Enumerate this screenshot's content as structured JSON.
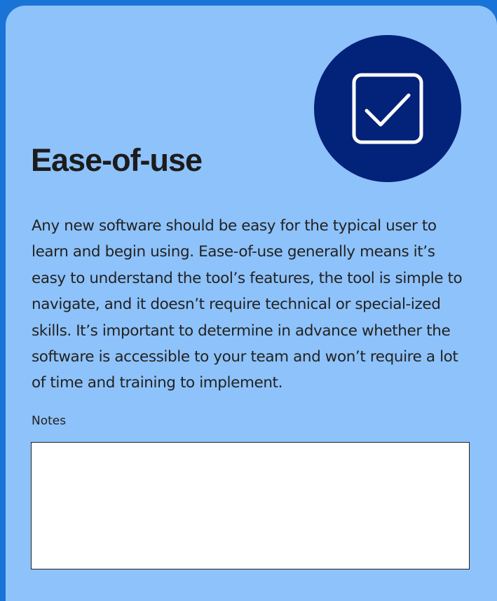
{
  "card": {
    "icon": "checkbox-checked-icon",
    "title": "Ease-of-use",
    "description": "Any new software should be easy for the typical user to learn and begin using. Ease-of-use generally means it’s easy to understand the tool’s features, the tool is simple to navigate, and it doesn’t require technical or special-ized skills. It’s important to determine in advance whether the software is accessible to your team and won’t require a lot of time and training to implement.",
    "notes_label": "Notes",
    "notes_value": ""
  },
  "colors": {
    "page_background": "#1a73d6",
    "card_background": "#8ec2fa",
    "badge_background": "#032279",
    "text": "#222222",
    "notes_background": "#ffffff"
  }
}
